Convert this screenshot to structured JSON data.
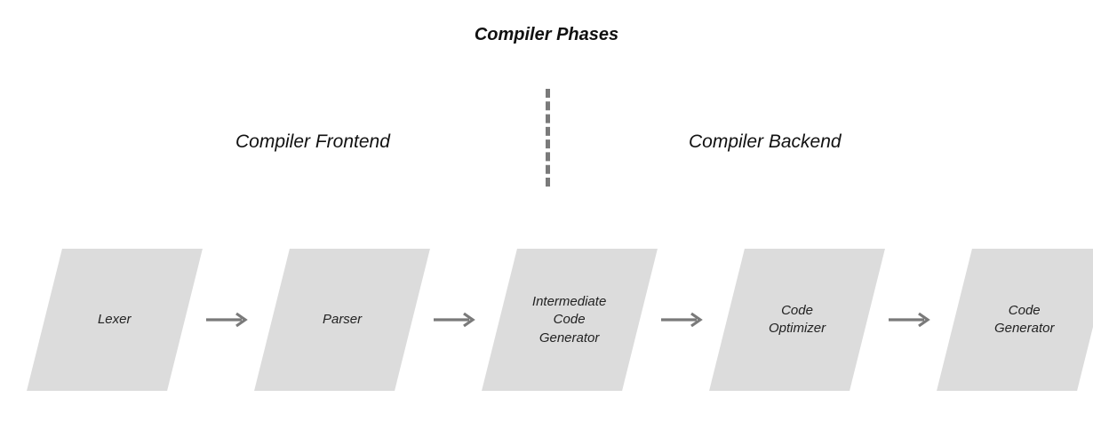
{
  "title": "Compiler Phases",
  "sections": {
    "frontend_label": "Compiler Frontend",
    "backend_label": "Compiler Backend"
  },
  "phases": [
    {
      "label": "Lexer"
    },
    {
      "label": "Parser"
    },
    {
      "label": "Intermediate\nCode\nGenerator"
    },
    {
      "label": "Code\nOptimizer"
    },
    {
      "label": "Code\nGenerator"
    }
  ]
}
